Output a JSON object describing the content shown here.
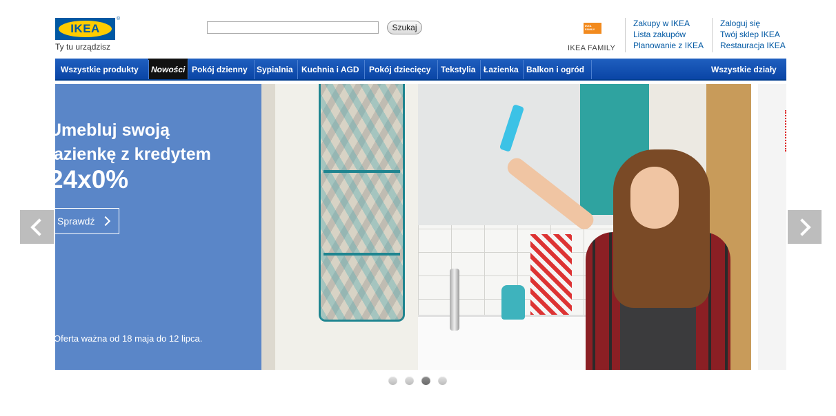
{
  "header": {
    "logo_text": "IKEA",
    "logo_reg": "®",
    "tagline": "Ty tu urządzisz",
    "search_placeholder": "",
    "search_button": "Szukaj",
    "family_logo_text": "IKEA FAMILY",
    "family_label": "IKEA FAMILY",
    "links_col1": [
      "Zakupy w IKEA",
      "Lista zakupów",
      "Planowanie z IKEA"
    ],
    "links_col2": [
      "Zaloguj się",
      "Twój sklep IKEA",
      "Restauracja IKEA"
    ]
  },
  "nav": {
    "items": [
      "Wszystkie produkty",
      "Nowości",
      "Pokój dzienny",
      "Sypialnia",
      "Kuchnia i AGD",
      "Pokój dziecięcy",
      "Tekstylia",
      "Łazienka",
      "Balkon i ogród"
    ],
    "right": "Wszystkie działy",
    "active_index": 1
  },
  "hero": {
    "line1": "Umebluj swoją",
    "line2": "łazienkę z kredytem",
    "line3": "24x0%",
    "cta": "Sprawdź",
    "footnote": "Oferta ważna od 18 maja do 12 lipca."
  },
  "carousel": {
    "slide_count": 4,
    "active_slide": 3
  },
  "colors": {
    "brand_blue": "#0058a3",
    "brand_yellow": "#ffcc00",
    "promo_blue": "#5a86c8",
    "link_blue": "#0058a3"
  }
}
